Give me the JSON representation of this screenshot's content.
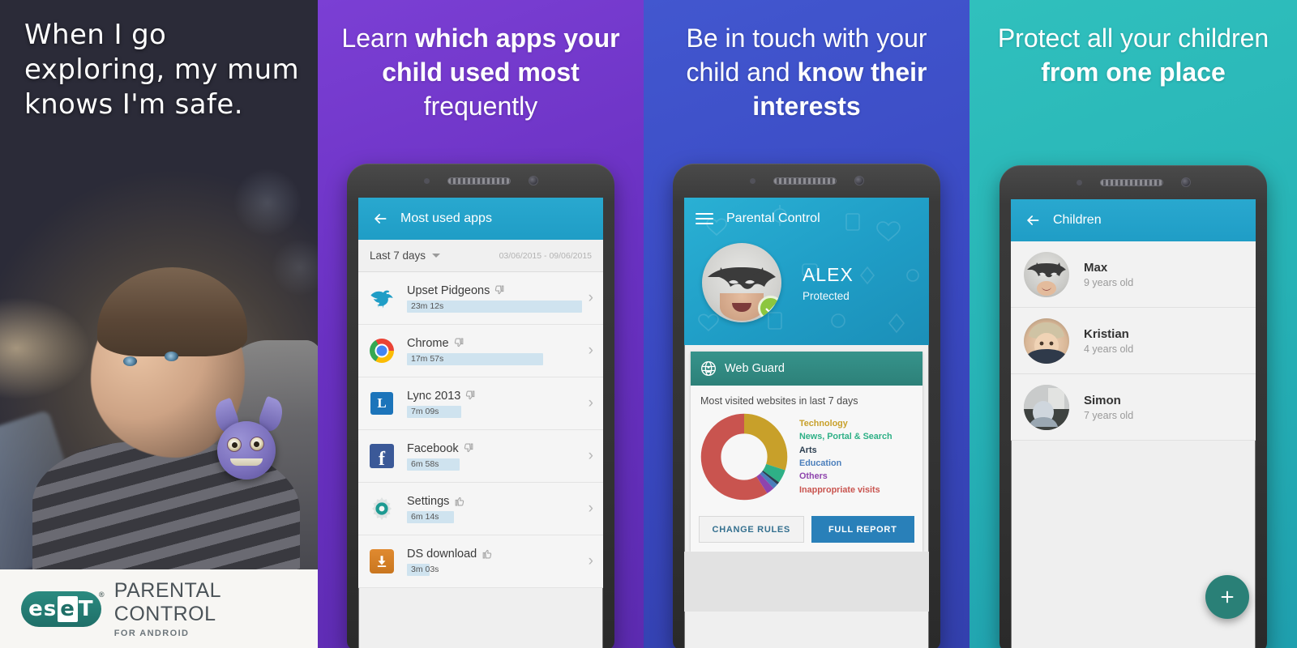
{
  "panels": {
    "photo": {
      "headline": "When I go exploring, my mum knows I'm safe.",
      "logo": {
        "mark_1": "es",
        "mark_2": "e",
        "mark_3": "T",
        "tm": "®",
        "title": "PARENTAL CONTROL",
        "subtitle": "FOR ANDROID"
      }
    },
    "apps": {
      "headline_parts": [
        {
          "text": "Learn ",
          "bold": false
        },
        {
          "text": "which apps your child used most",
          "bold": true
        },
        {
          "text": " frequently",
          "bold": false
        }
      ],
      "headline_plain": "Learn which apps your child used most frequently",
      "screen": {
        "back_icon": "arrow-left-icon",
        "title": "Most used apps",
        "filter_label": "Last 7 days",
        "filter_caret": "chevron-down-icon",
        "date_range": "03/06/2015 - 09/06/2015",
        "rows": [
          {
            "name": "Upset Pidgeons",
            "time": "23m 12s",
            "rating": "thumbs-down",
            "bar_pct": 100,
            "icon": "bird-icon"
          },
          {
            "name": "Chrome",
            "time": "17m 57s",
            "rating": "thumbs-down",
            "bar_pct": 78,
            "icon": "chrome-icon"
          },
          {
            "name": "Lync 2013",
            "time": "7m 09s",
            "rating": "thumbs-down",
            "bar_pct": 31,
            "icon": "lync-icon"
          },
          {
            "name": "Facebook",
            "time": "6m 58s",
            "rating": "thumbs-down",
            "bar_pct": 30,
            "icon": "facebook-icon"
          },
          {
            "name": "Settings",
            "time": "6m 14s",
            "rating": "thumbs-up",
            "bar_pct": 27,
            "icon": "settings-gear-icon"
          },
          {
            "name": "DS download",
            "time": "3m 03s",
            "rating": "thumbs-up",
            "bar_pct": 13,
            "icon": "download-icon"
          }
        ]
      }
    },
    "touch": {
      "headline_parts": [
        {
          "text": "Be in touch with your child and ",
          "bold": false
        },
        {
          "text": "know their interests",
          "bold": true
        }
      ],
      "headline_plain": "Be in touch with your child and know their interests",
      "screen": {
        "menu_icon": "hamburger-menu-icon",
        "title": "Parental Control",
        "child_name": "ALEX",
        "child_status": "Protected",
        "status_badge_icon": "check-circle-icon",
        "card": {
          "icon": "web-guard-globe-icon",
          "title": "Web Guard",
          "caption": "Most visited websites in last 7 days",
          "buttons": {
            "secondary": "CHANGE RULES",
            "primary": "FULL REPORT"
          }
        }
      }
    },
    "children": {
      "headline_parts": [
        {
          "text": "Protect all your children ",
          "bold": false
        },
        {
          "text": "from one place",
          "bold": true
        }
      ],
      "headline_plain": "Protect all your children from one place",
      "screen": {
        "back_icon": "arrow-left-icon",
        "title": "Children",
        "rows": [
          {
            "name": "Max",
            "age": "9 years old",
            "avatar": "avatar-max"
          },
          {
            "name": "Kristian",
            "age": "4 years old",
            "avatar": "avatar-kristian"
          },
          {
            "name": "Simon",
            "age": "7 years old",
            "avatar": "avatar-simon"
          }
        ],
        "fab_icon": "plus-icon"
      }
    }
  },
  "chart_data": {
    "type": "pie",
    "title": "Most visited websites in last 7 days",
    "legend_position": "right",
    "categories": [
      "Technology",
      "News, Portal & Search",
      "Arts",
      "Education",
      "Others",
      "Inappropriate visits"
    ],
    "values": [
      30,
      5,
      1,
      2,
      3,
      59
    ],
    "colors": [
      "#c8a02a",
      "#2eb086",
      "#2c3e50",
      "#4a7ebb",
      "#8e44ad",
      "#c9544f"
    ],
    "labels": [
      "Technology",
      "News, Portal & Search",
      "Arts",
      "Education",
      "Others",
      "Inappropriate visits"
    ],
    "donut": true,
    "inner_radius_pct": 46
  },
  "colors": {
    "panel_apps_bg": "#6a31c2",
    "panel_touch_bg": "#3a49c2",
    "panel_children_bg": "#27b3b6",
    "photo_bg": "#2c2c3c",
    "appbar": "#1f9dc6",
    "card_head": "#2d8179",
    "primary_button": "#2980b9",
    "fab": "#2a8077",
    "eset_teal": "#1f6f68",
    "bar_fill": "#cfe3ef",
    "badge_green": "#8cc63f"
  }
}
